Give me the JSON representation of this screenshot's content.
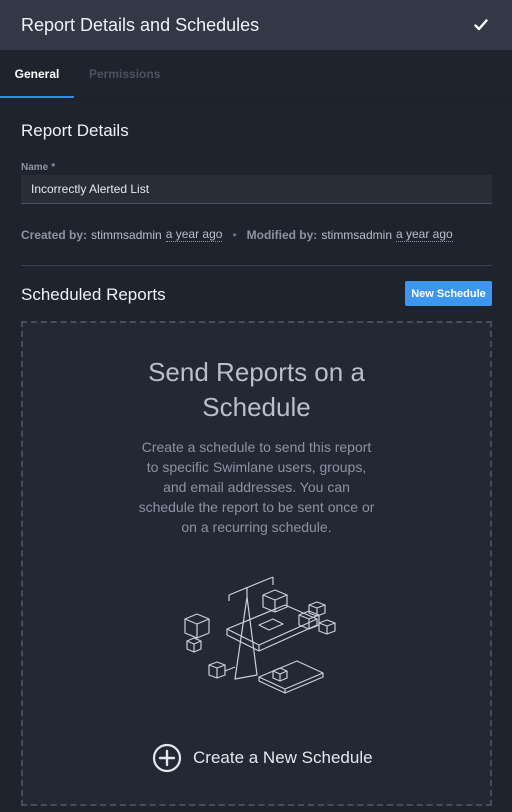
{
  "header": {
    "title": "Report Details and Schedules"
  },
  "tabs": [
    {
      "label": "General",
      "active": true
    },
    {
      "label": "Permissions",
      "active": false
    }
  ],
  "details": {
    "title": "Report Details",
    "name_label": "Name",
    "name_required": "*",
    "name_value": "Incorrectly Alerted List",
    "created_by_label": "Created by:",
    "created_by": "stimmsadmin",
    "created_time": "a year ago",
    "separator": "•",
    "modified_by_label": "Modified by:",
    "modified_by": "stimmsadmin",
    "modified_time": "a year ago"
  },
  "schedules": {
    "title": "Scheduled Reports",
    "new_button": "New Schedule",
    "empty_heading": "Send Reports on a Schedule",
    "empty_text": "Create a schedule to send this report to specific Swimlane users, groups, and email addresses. You can schedule the report to be sent once or on a recurring schedule.",
    "create_label": "Create a New Schedule"
  },
  "colors": {
    "accent": "#3d96ef",
    "header_bg": "#323846",
    "panel_bg": "#1f232d"
  },
  "icons": [
    "check-icon",
    "plus-circle-icon",
    "schedule-illustration"
  ]
}
